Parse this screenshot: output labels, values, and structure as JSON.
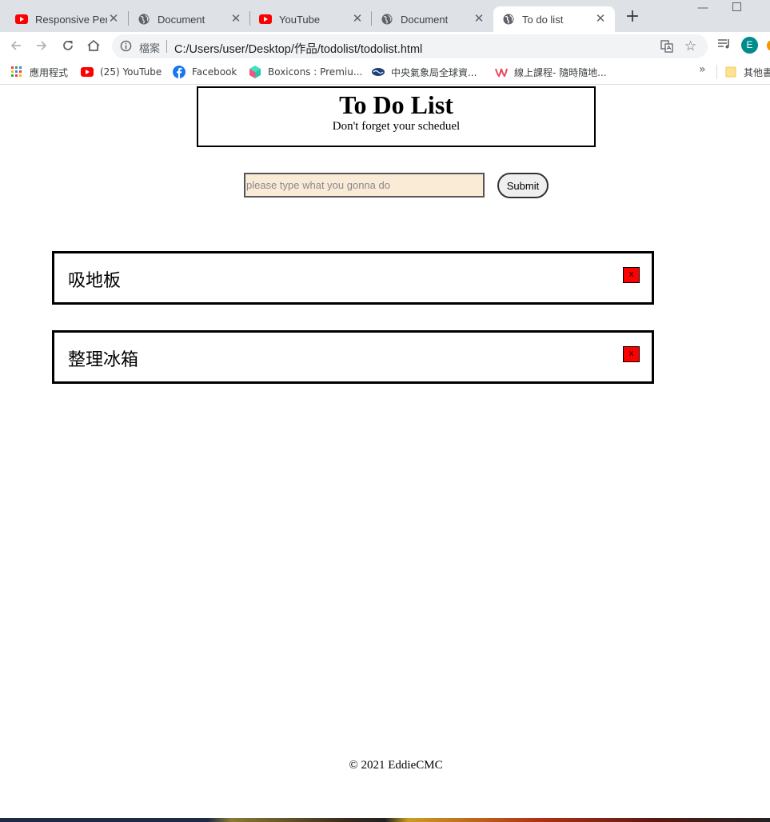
{
  "browser": {
    "tabs": [
      {
        "title": "Responsive Pers",
        "icon": "youtube-icon"
      },
      {
        "title": "Document",
        "icon": "globe-icon"
      },
      {
        "title": "YouTube",
        "icon": "youtube-icon"
      },
      {
        "title": "Document",
        "icon": "globe-icon"
      },
      {
        "title": "To do list",
        "icon": "globe-icon",
        "active": true
      }
    ],
    "address": {
      "scheme_label": "檔案",
      "url": "C:/Users/user/Desktop/作品/todolist/todolist.html"
    },
    "profile_initial": "E",
    "bookmarks": [
      {
        "label": "應用程式",
        "icon": "apps-grid-icon"
      },
      {
        "label": "(25) YouTube",
        "icon": "youtube-icon"
      },
      {
        "label": "Facebook",
        "icon": "facebook-icon"
      },
      {
        "label": "Boxicons : Premiu...",
        "icon": "boxicons-icon"
      },
      {
        "label": "中央氣象局全球資...",
        "icon": "cwb-icon"
      },
      {
        "label": "線上課程- 隨時隨地...",
        "icon": "hahow-icon"
      },
      {
        "label": "其他書",
        "icon": "folder-icon"
      }
    ],
    "bookmarks_overflow": "»"
  },
  "page": {
    "header": {
      "title": "To Do List",
      "subtitle": "Don't forget your scheduel"
    },
    "form": {
      "input_placeholder": "please type what you gonna do",
      "input_value": "",
      "submit_label": "Submit"
    },
    "todos": [
      {
        "text": "吸地板",
        "delete_label": "x"
      },
      {
        "text": "整理冰箱",
        "delete_label": "x"
      }
    ],
    "footer": "© 2021 EddieCMC"
  },
  "colors": {
    "input_bg": "#faebd7",
    "delete_button": "#ff0000",
    "youtube_red": "#ff0000",
    "avatar": "#008c8c"
  }
}
